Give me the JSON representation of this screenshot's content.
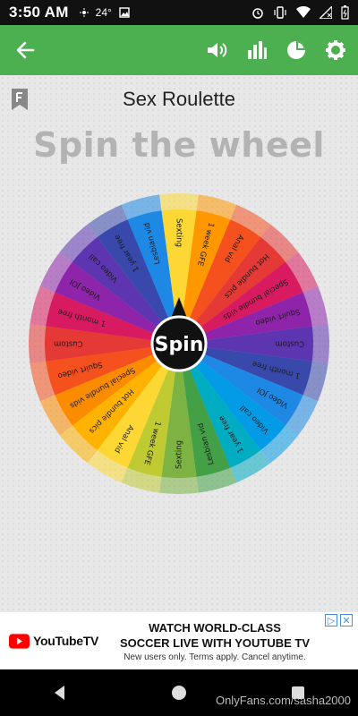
{
  "status": {
    "time": "3:50 AM",
    "temp": "24°",
    "icons_left": [
      "location-icon",
      "image-icon"
    ],
    "icons_right": [
      "alarm-icon",
      "vibrate-icon",
      "wifi-icon",
      "signal-icon",
      "battery-icon"
    ]
  },
  "appbar": {
    "color": "#4caf50",
    "icons": [
      "back-arrow-icon",
      "volume-icon",
      "stats-icon",
      "pie-chart-icon",
      "settings-icon"
    ]
  },
  "screen": {
    "title": "Sex Roulette",
    "heading": "Spin the wheel",
    "spin_label": "Spin"
  },
  "wheel": {
    "segments": [
      {
        "label": "Sexting",
        "color": "#fdd835"
      },
      {
        "label": "1 week GFE",
        "color": "#ff9800"
      },
      {
        "label": "Anal vid",
        "color": "#f4511e"
      },
      {
        "label": "Hot bundle pics",
        "color": "#e53935"
      },
      {
        "label": "Special bundle vids",
        "color": "#d81b60"
      },
      {
        "label": "Squirt video",
        "color": "#8e24aa"
      },
      {
        "label": "Custom",
        "color": "#5e35b1"
      },
      {
        "label": "1 month free",
        "color": "#3949ab"
      },
      {
        "label": "Video JOI",
        "color": "#1e88e5"
      },
      {
        "label": "Video call",
        "color": "#039be5"
      },
      {
        "label": "1 year free",
        "color": "#00acc1"
      },
      {
        "label": "Lesbian vid",
        "color": "#43a047"
      },
      {
        "label": "Sexting",
        "color": "#7cb342"
      },
      {
        "label": "1 week GFE",
        "color": "#c0ca33"
      },
      {
        "label": "Anal vid",
        "color": "#fdd835"
      },
      {
        "label": "Hot bundle pics",
        "color": "#ffb300"
      },
      {
        "label": "Special bundle vids",
        "color": "#fb8c00"
      },
      {
        "label": "Squirt video",
        "color": "#f4511e"
      },
      {
        "label": "Custom",
        "color": "#e53935"
      },
      {
        "label": "1 month free",
        "color": "#d81b60"
      },
      {
        "label": "Video JOI",
        "color": "#8e24aa"
      },
      {
        "label": "Video call",
        "color": "#5e35b1"
      },
      {
        "label": "1 year free",
        "color": "#3949ab"
      },
      {
        "label": "Lesbian vid",
        "color": "#1e88e5"
      }
    ]
  },
  "ad": {
    "brand": "YouTubeTV",
    "headline_1": "WATCH WORLD-CLASS",
    "headline_2": "SOCCER LIVE WITH YOUTUBE TV",
    "subline": "New users only. Terms apply. Cancel anytime.",
    "adchoices_info": "▷",
    "adchoices_close": "✕"
  },
  "watermark": "OnlyFans.com/sasha2000"
}
